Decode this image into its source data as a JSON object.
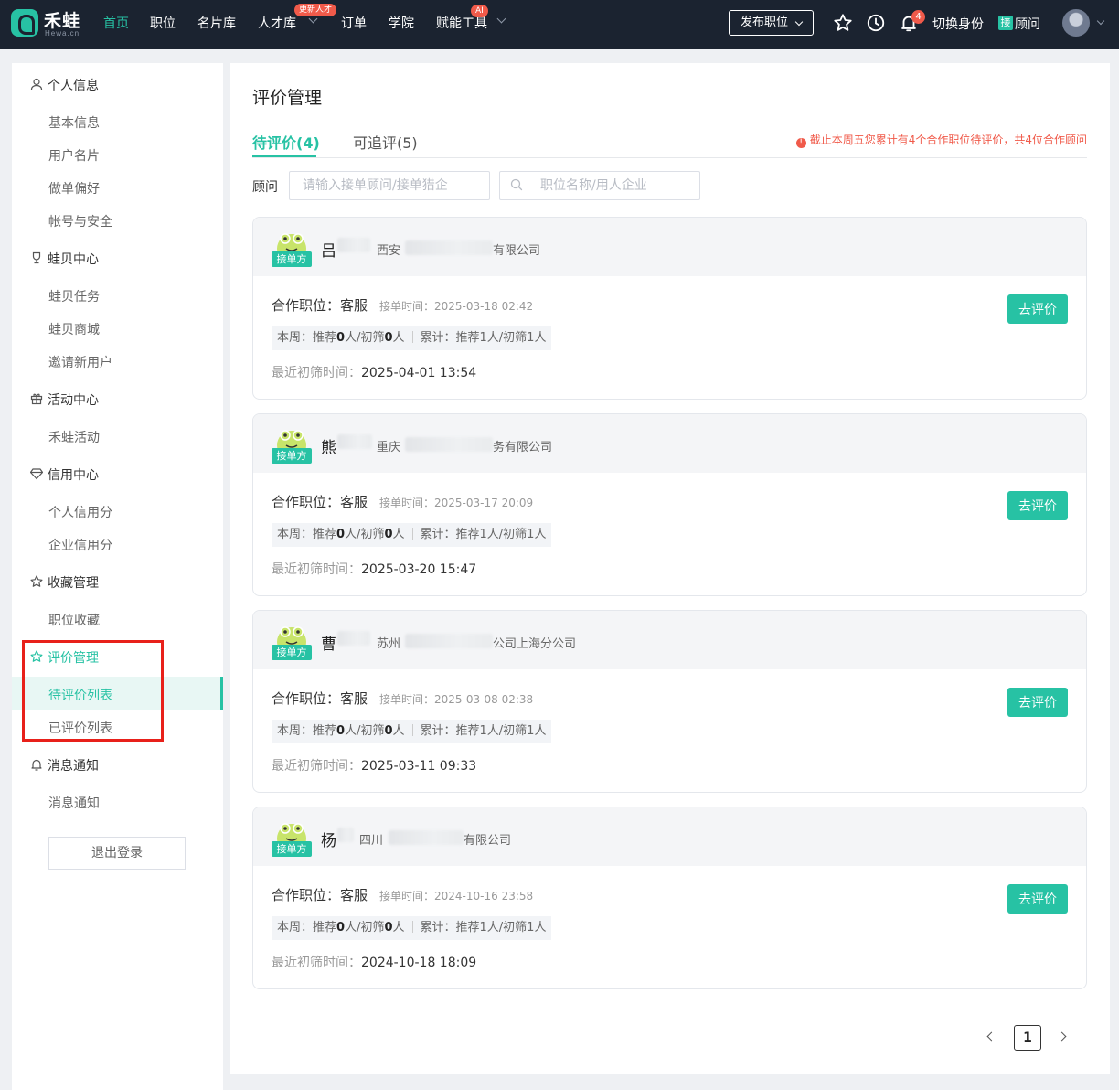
{
  "header": {
    "logo_text": "禾蛙",
    "logo_sub": "Hewa.cn",
    "nav": [
      {
        "label": "首页",
        "badge": ""
      },
      {
        "label": "职位",
        "badge": ""
      },
      {
        "label": "名片库",
        "badge": ""
      },
      {
        "label": "人才库",
        "badge": "更新人才"
      },
      {
        "label": "订单",
        "badge": ""
      },
      {
        "label": "学院",
        "badge": ""
      },
      {
        "label": "赋能工具",
        "badge": "AI"
      }
    ],
    "publish_label": "发布职位",
    "notification_count": "4",
    "switch_identity": "切换身份",
    "role_tag": "接",
    "role_name": "顾问"
  },
  "sidebar": {
    "groups": [
      {
        "label": "个人信息",
        "icon": "user-icon",
        "items": [
          "基本信息",
          "用户名片",
          "做单偏好",
          "帐号与安全"
        ]
      },
      {
        "label": "蛙贝中心",
        "icon": "trophy-icon",
        "items": [
          "蛙贝任务",
          "蛙贝商城",
          "邀请新用户"
        ]
      },
      {
        "label": "活动中心",
        "icon": "gift-icon",
        "items": [
          "禾蛙活动"
        ]
      },
      {
        "label": "信用中心",
        "icon": "diamond-icon",
        "items": [
          "个人信用分",
          "企业信用分"
        ]
      },
      {
        "label": "收藏管理",
        "icon": "star-icon",
        "items": [
          "职位收藏"
        ]
      },
      {
        "label": "评价管理",
        "icon": "star-icon",
        "items": [
          "待评价列表",
          "已评价列表"
        ]
      },
      {
        "label": "消息通知",
        "icon": "bell-icon",
        "items": [
          "消息通知"
        ]
      }
    ],
    "logout": "退出登录"
  },
  "main": {
    "title": "评价管理",
    "tabs": [
      "待评价(4)",
      "可追评(5)"
    ],
    "notice": "截止本周五您累计有4个合作职位待评价，共4位合作顾问",
    "filter_label": "顾问",
    "consultant_placeholder": "请输入接单顾问/接单猎企",
    "job_placeholder": "职位名称/用人企业",
    "card_tag": "接单方",
    "card_labels": {
      "job_prefix": "合作职位：",
      "time_prefix": "接单时间：",
      "week_prefix": "本周：推荐",
      "person_initial_sep": "人/初筛",
      "person_suffix": "人",
      "total": "累计：推荐1人/初筛1人",
      "last_prefix": "最近初筛时间：",
      "button": "去评价"
    },
    "cards": [
      {
        "name": "吕",
        "company_pre": "西安",
        "company_suf": "有限公司",
        "job": "客服",
        "time": "2025-03-18 02:42",
        "week_rec": "0",
        "week_init": "0",
        "last": "2025-04-01 13:54"
      },
      {
        "name": "熊",
        "company_pre": "重庆",
        "company_suf": "务有限公司",
        "job": "客服",
        "time": "2025-03-17 20:09",
        "week_rec": "0",
        "week_init": "0",
        "last": "2025-03-20 15:47"
      },
      {
        "name": "曹",
        "company_pre": "苏州",
        "company_suf": "公司上海分公司",
        "job": "客服",
        "time": "2025-03-08 02:38",
        "week_rec": "0",
        "week_init": "0",
        "last": "2025-03-11 09:33"
      },
      {
        "name": "杨",
        "company_pre": "四川",
        "company_suf": "有限公司",
        "job": "客服",
        "time": "2024-10-16 23:58",
        "week_rec": "0",
        "week_init": "0",
        "last": "2024-10-18 18:09"
      }
    ],
    "pagination": {
      "current": "1"
    }
  },
  "colors": {
    "accent": "#27c2a4",
    "nav_bg": "#1b2330",
    "alert": "#f05a4a"
  }
}
